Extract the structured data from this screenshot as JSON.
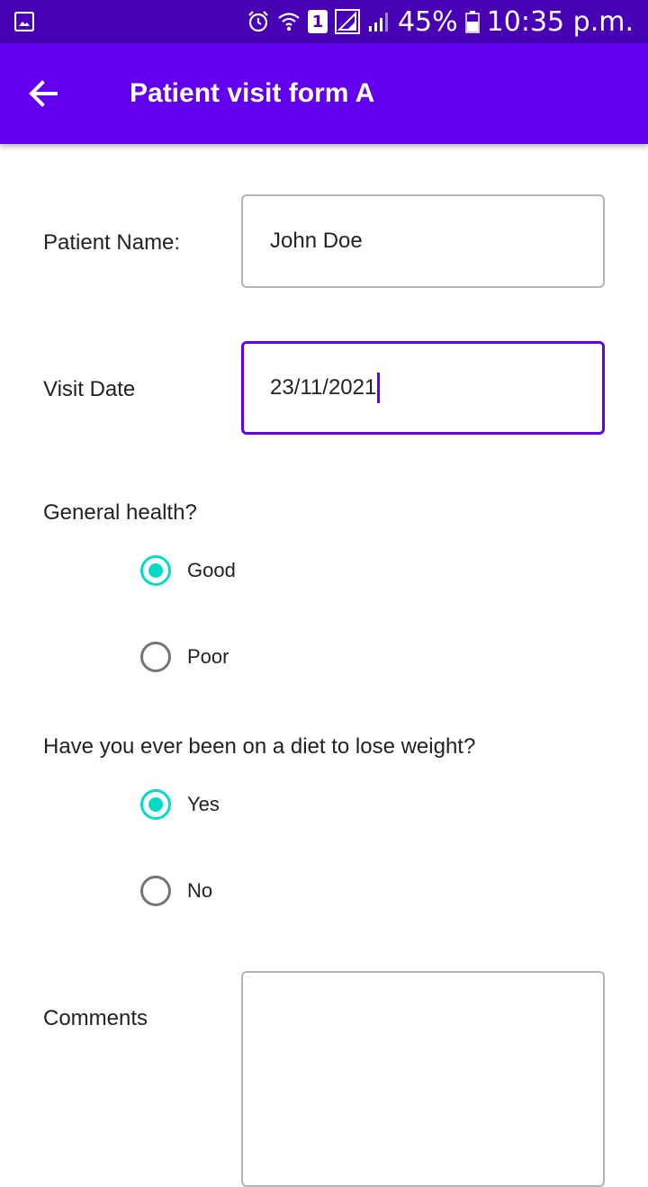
{
  "status_bar": {
    "battery_percent": "45%",
    "time": "10:35 p.m.",
    "sim_slot": "1",
    "icons": [
      "gallery-icon",
      "alarm-icon",
      "wifi-icon",
      "sim-icon",
      "signal-icon",
      "signal-icon",
      "battery-icon"
    ]
  },
  "app_bar": {
    "title": "Patient visit form A",
    "back_icon": "arrow-back-icon"
  },
  "form": {
    "patient_name": {
      "label": "Patient Name:",
      "value": "John Doe"
    },
    "visit_date": {
      "label": "Visit Date",
      "value": "23/11/2021"
    },
    "general_health": {
      "question": "General health?",
      "options": [
        {
          "label": "Good",
          "selected": true
        },
        {
          "label": "Poor",
          "selected": false
        }
      ]
    },
    "diet": {
      "question": "Have you ever been on a diet to lose weight?",
      "options": [
        {
          "label": "Yes",
          "selected": true
        },
        {
          "label": "No",
          "selected": false
        }
      ]
    },
    "comments": {
      "label": "Comments",
      "value": ""
    }
  },
  "colors": {
    "status_bar": "#4700b3",
    "app_bar": "#6200ee",
    "radio_checked": "#03dac5",
    "radio_unchecked": "#757575",
    "focus_border": "#6200ee",
    "input_border": "#b3b3b3"
  }
}
